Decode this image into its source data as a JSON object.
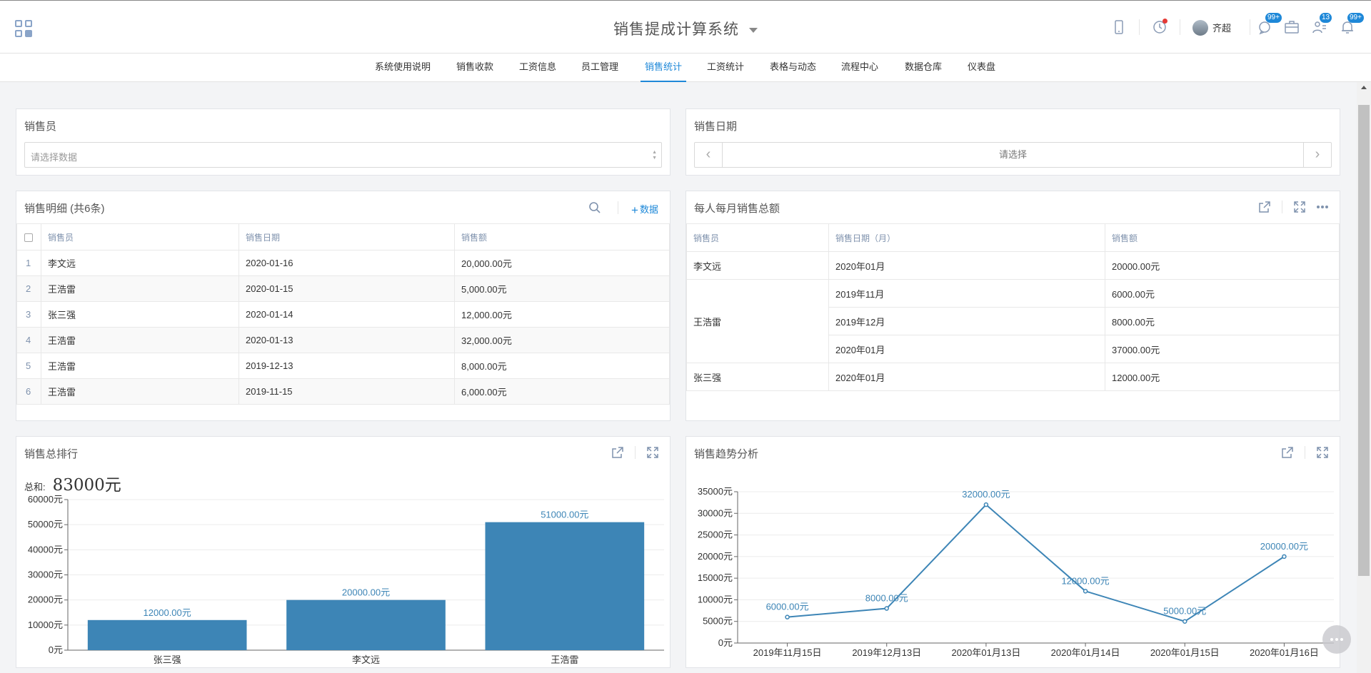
{
  "header": {
    "title": "销售提成计算系统",
    "user_name": "齐超",
    "badges": {
      "messages": "99+",
      "tasks": "13",
      "notifications": "99+"
    }
  },
  "nav": {
    "items": [
      "系统使用说明",
      "销售收款",
      "工资信息",
      "员工管理",
      "销售统计",
      "工资统计",
      "表格与动态",
      "流程中心",
      "数据仓库",
      "仪表盘"
    ],
    "active": "销售统计"
  },
  "filters": {
    "salesperson": {
      "label": "销售员",
      "placeholder": "请选择数据"
    },
    "sale_date": {
      "label": "销售日期",
      "placeholder": "请选择"
    }
  },
  "details": {
    "title": "销售明细 (共6条)",
    "add_label": "数据",
    "columns": [
      "销售员",
      "销售日期",
      "销售额"
    ],
    "rows": [
      {
        "idx": "1",
        "name": "李文远",
        "date": "2020-01-16",
        "amount": "20,000.00元"
      },
      {
        "idx": "2",
        "name": "王浩雷",
        "date": "2020-01-15",
        "amount": "5,000.00元"
      },
      {
        "idx": "3",
        "name": "张三强",
        "date": "2020-01-14",
        "amount": "12,000.00元"
      },
      {
        "idx": "4",
        "name": "王浩雷",
        "date": "2020-01-13",
        "amount": "32,000.00元"
      },
      {
        "idx": "5",
        "name": "王浩雷",
        "date": "2019-12-13",
        "amount": "8,000.00元"
      },
      {
        "idx": "6",
        "name": "王浩雷",
        "date": "2019-11-15",
        "amount": "6,000.00元"
      }
    ]
  },
  "monthly": {
    "title": "每人每月销售总额",
    "columns": [
      "销售员",
      "销售日期（月）",
      "销售额"
    ],
    "groups": [
      {
        "name": "李文远",
        "rows": [
          {
            "month": "2020年01月",
            "amount": "20000.00元"
          }
        ]
      },
      {
        "name": "王浩雷",
        "rows": [
          {
            "month": "2019年11月",
            "amount": "6000.00元"
          },
          {
            "month": "2019年12月",
            "amount": "8000.00元"
          },
          {
            "month": "2020年01月",
            "amount": "37000.00元"
          }
        ]
      },
      {
        "name": "张三强",
        "rows": [
          {
            "month": "2020年01月",
            "amount": "12000.00元"
          }
        ]
      }
    ]
  },
  "ranking": {
    "title": "销售总排行",
    "total_label": "总和:",
    "total_value": "83000元"
  },
  "trend": {
    "title": "销售趋势分析"
  },
  "chart_data": [
    {
      "type": "bar",
      "title": "销售总排行",
      "categories": [
        "张三强",
        "李文远",
        "王浩雷"
      ],
      "values": [
        12000,
        20000,
        51000
      ],
      "value_labels": [
        "12000.00元",
        "20000.00元",
        "51000.00元"
      ],
      "ylim": [
        0,
        60000
      ],
      "yticks": [
        0,
        10000,
        20000,
        30000,
        40000,
        50000,
        60000
      ],
      "ytick_labels": [
        "0元",
        "10000元",
        "20000元",
        "30000元",
        "40000元",
        "50000元",
        "60000元"
      ],
      "grid": true,
      "color": "#3d85b6"
    },
    {
      "type": "line",
      "title": "销售趋势分析",
      "categories": [
        "2019年11月15日",
        "2019年12月13日",
        "2020年01月13日",
        "2020年01月14日",
        "2020年01月15日",
        "2020年01月16日"
      ],
      "values": [
        6000,
        8000,
        32000,
        12000,
        5000,
        20000
      ],
      "value_labels": [
        "6000.00元",
        "8000.00元",
        "32000.00元",
        "12000.00元",
        "5000.00元",
        "20000.00元"
      ],
      "ylim": [
        0,
        35000
      ],
      "yticks": [
        0,
        5000,
        10000,
        15000,
        20000,
        25000,
        30000,
        35000
      ],
      "ytick_labels": [
        "0元",
        "5000元",
        "10000元",
        "15000元",
        "20000元",
        "25000元",
        "30000元",
        "35000元"
      ],
      "grid": true,
      "color": "#3d85b6"
    }
  ],
  "colors": {
    "accent": "#1e88d8",
    "series": "#3d85b6",
    "badge": "#1e88d8"
  }
}
